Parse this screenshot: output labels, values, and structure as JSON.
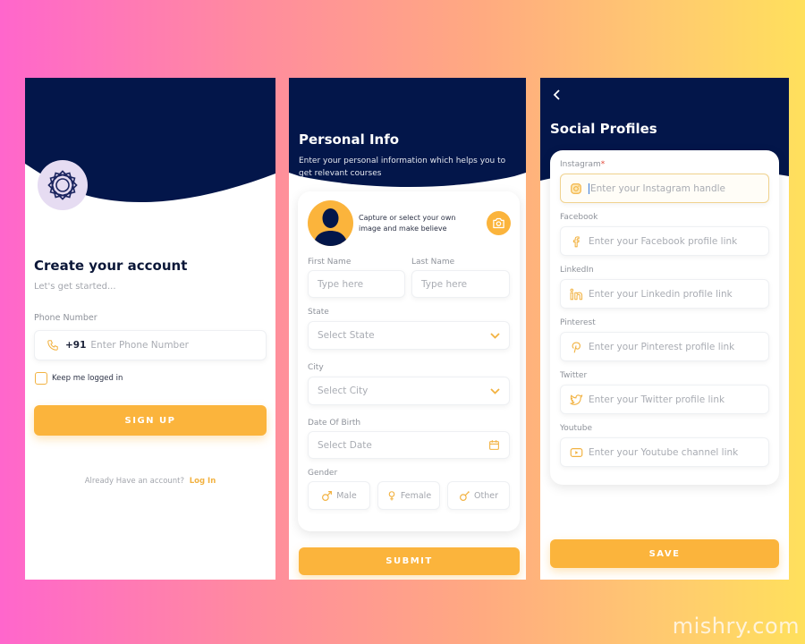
{
  "colors": {
    "navy": "#03164a",
    "accent": "#fbb43c",
    "label": "#8e929a",
    "placeholder": "#a9acb3"
  },
  "create_account": {
    "title": "Create your account",
    "subtitle": "Let's get started...",
    "phone_label": "Phone Number",
    "phone_prefix": "+91",
    "phone_placeholder": "Enter Phone Number",
    "keep_logged_in": "Keep me logged in",
    "keep_logged_in_checked": false,
    "signup_button": "SIGN UP",
    "already_text": "Already Have an account?",
    "login_link": "Log In"
  },
  "personal_info": {
    "title": "Personal Info",
    "subtitle": "Enter your personal information which helps you to get relevant courses",
    "capture_text": "Capture or select your own image and make believe",
    "first_name_label": "First Name",
    "first_name_placeholder": "Type here",
    "last_name_label": "Last Name",
    "last_name_placeholder": "Type here",
    "state_label": "State",
    "state_placeholder": "Select State",
    "city_label": "City",
    "city_placeholder": "Select City",
    "dob_label": "Date Of Birth",
    "dob_placeholder": "Select Date",
    "gender_label": "Gender",
    "gender_options": [
      "Male",
      "Female",
      "Other"
    ],
    "submit_button": "SUBMIT"
  },
  "social_profiles": {
    "title": "Social Profiles",
    "fields": [
      {
        "label": "Instagram",
        "required_mark": "*",
        "placeholder": "Enter your Instagram handle",
        "icon": "instagram-icon"
      },
      {
        "label": "Facebook",
        "placeholder": "Enter your Facebook profile link",
        "icon": "facebook-icon"
      },
      {
        "label": "LinkedIn",
        "placeholder": "Enter your Linkedin profile link",
        "icon": "linkedin-icon"
      },
      {
        "label": "Pinterest",
        "placeholder": "Enter your Pinterest profile link",
        "icon": "pinterest-icon"
      },
      {
        "label": "Twitter",
        "placeholder": "Enter your Twitter profile link",
        "icon": "twitter-icon"
      },
      {
        "label": "Youtube",
        "placeholder": "Enter your Youtube channel link",
        "icon": "youtube-icon"
      }
    ],
    "save_button": "SAVE"
  },
  "watermark": "mishry.com"
}
